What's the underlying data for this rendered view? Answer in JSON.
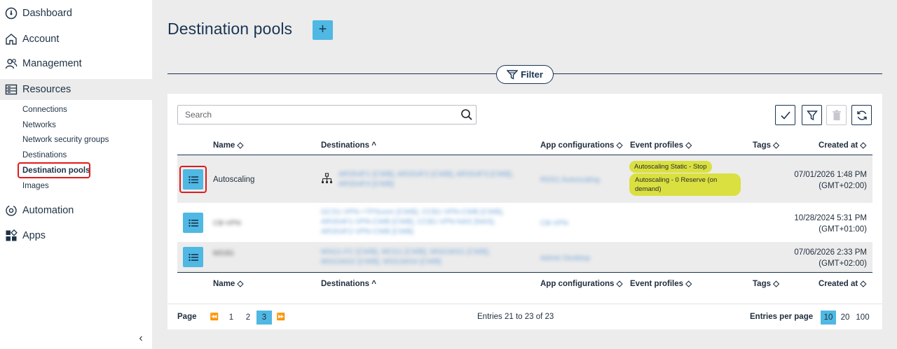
{
  "sidebar": {
    "items": [
      {
        "label": "Dashboard",
        "icon": "gauge-icon"
      },
      {
        "label": "Account",
        "icon": "home-icon"
      },
      {
        "label": "Management",
        "icon": "users-icon"
      },
      {
        "label": "Resources",
        "icon": "server-icon"
      },
      {
        "label": "Automation",
        "icon": "gear-sync-icon"
      },
      {
        "label": "Apps",
        "icon": "apps-icon"
      }
    ],
    "sub_items": [
      "Connections",
      "Networks",
      "Network security groups",
      "Destinations",
      "Destination pools",
      "Images"
    ],
    "collapse": "‹"
  },
  "header": {
    "title": "Destination pools",
    "add_label": "+"
  },
  "filter": {
    "label": "Filter"
  },
  "search": {
    "placeholder": "Search"
  },
  "table": {
    "columns": [
      "Name ◇",
      "Destinations ^",
      "App configurations ◇",
      "Event profiles ◇",
      "Tags ◇",
      "Created at ◇"
    ],
    "rows": [
      {
        "name": "Autoscaling",
        "destinations": "AR3S4F1 [CWB], AR3S4F2 [CWB], AR3S4F3 [CWB], AR3S4F4 [CWB]",
        "app_config": "RDS1 Autoscaling",
        "events": [
          "Autoscaling Static - Stop",
          "Autoscaling - 0 Reserve (on demand)"
        ],
        "created_date": "07/01/2026 1:48 PM",
        "created_tz": "(GMT+02:00)"
      },
      {
        "name": "CB-VPN",
        "destinations": "GCS1-VPN-+TPSuren [CWB], CCB1-VPN-CWB [CWB], AR3S4F1-VPN-CWB [CWB], CCB1-VPN-NAS [NAS], AR3S4F2-VPN-CWB [CWB]",
        "app_config": "CB-VPN",
        "events": [],
        "created_date": "10/28/2024 5:31 PM",
        "created_tz": "(GMT+01:00)"
      },
      {
        "name": "MS3G",
        "destinations": "MSG1-FC [CWB], MCG1 [CWB], MSG3AS1 [CWB], MSG3AS2 [CWB], MSG3AS4 [CWB]",
        "app_config": "Admin Desktop",
        "events": [],
        "created_date": "07/06/2026 2:33 PM",
        "created_tz": "(GMT+02:00)"
      }
    ]
  },
  "pagination": {
    "page_label": "Page",
    "first": "⏪",
    "pages": [
      "1",
      "2",
      "3"
    ],
    "current": "3",
    "next": "⏩",
    "entries_text": "Entries 21 to 23 of 23",
    "per_page_label": "Entries per page",
    "per_page_options": [
      "10",
      "20",
      "100"
    ],
    "per_page_selected": "10"
  },
  "colors": {
    "accent": "#4fb8e3",
    "navy": "#1a3552",
    "event_tag": "#d9e040",
    "highlight": "#e01b1b"
  }
}
